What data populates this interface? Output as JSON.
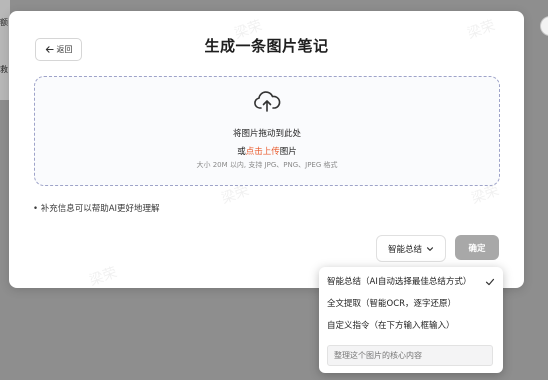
{
  "background": {
    "text_1": "额",
    "text_2": "救"
  },
  "modal": {
    "back_label": "返回",
    "title": "生成一条图片笔记",
    "watermark": "梁荣"
  },
  "dropzone": {
    "title": "将图片拖动到此处",
    "or_text": "或",
    "upload_link": "点击上传",
    "image_word": "图片",
    "hint": "大小 20M 以内, 支持 JPG、PNG、JPEG 格式"
  },
  "info": {
    "text": "• 补充信息可以帮助AI更好地理解"
  },
  "controls": {
    "mode_label": "智能总结",
    "confirm_label": "确定"
  },
  "dropdown": {
    "options": [
      {
        "label": "智能总结（AI自动选择最佳总结方式）",
        "selected": true
      },
      {
        "label": "全文提取（智能OCR，逐字还原）",
        "selected": false
      },
      {
        "label": "自定义指令（在下方输入框输入）",
        "selected": false
      }
    ],
    "input_placeholder": "整理这个图片的核心内容"
  },
  "colors": {
    "accent_link": "#e95a2c",
    "dashed_border": "#9ea3c9",
    "confirm_bg": "#a8a8a8"
  }
}
